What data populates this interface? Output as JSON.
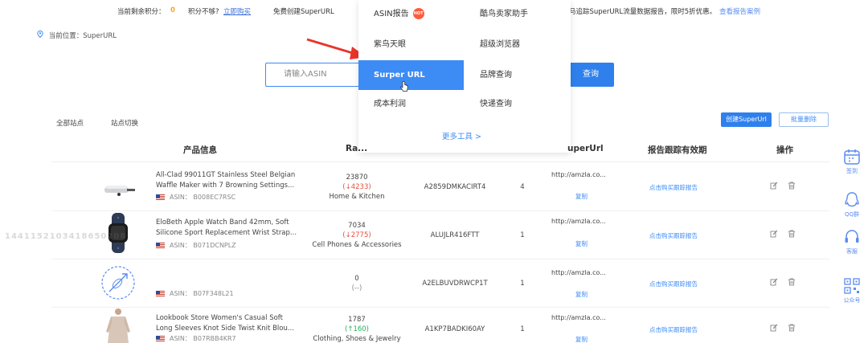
{
  "topbar": {
    "credits_label": "当前剩余积分：",
    "credits_value": "0",
    "not_enough": "积分不够?",
    "buy_now": "立即购买",
    "free_create": "免费创建SuperURL",
    "promo": "马追踪SuperURL流量数据报告，限时5折优惠。",
    "view_sample": "查看报告案例"
  },
  "location": {
    "label": "当前位置：SuperURL"
  },
  "search": {
    "placeholder": "请输入ASIN",
    "query_button": "查询"
  },
  "menu": {
    "items": [
      {
        "label": "ASIN报告",
        "badge": "HOT"
      },
      {
        "label": "酷鸟卖家助手"
      },
      {
        "label": "紫鸟天眼"
      },
      {
        "label": "超级浏览器"
      },
      {
        "label": "Surper URL"
      },
      {
        "label": "品牌查询"
      },
      {
        "label": "成本利润"
      },
      {
        "label": "快递查询"
      }
    ],
    "more": "更多工具 >"
  },
  "filters": {
    "all_sites": "全部站点",
    "switch_site": "站点切换"
  },
  "actions": {
    "create": "创建SuperUrl",
    "batch_delete": "批量删除"
  },
  "table": {
    "headers": {
      "product": "产品信息",
      "rank": "Ra...",
      "superurl": "uperUrl",
      "tracking": "报告跟踪有效期",
      "ops": "操作"
    },
    "rows": [
      {
        "title": "All-Clad 99011GT Stainless Steel Belgian Waffle Maker with 7 Browning Settings...",
        "asin": "ASIN： B008EC7RSC",
        "rank": "23870",
        "rank_change": "(↓4233)",
        "category": "Home & Kitchen",
        "asin_code": "A2859DMKACIRT4",
        "count": "4",
        "url": "http://amzla.co...",
        "copy": "复制",
        "report": "点击购买跟踪报告"
      },
      {
        "title": "EloBeth Apple Watch Band 42mm, Soft Silicone Sport Replacement Wrist Strap...",
        "asin": "ASIN： B071DCNPLZ",
        "rank": "7034",
        "rank_change": "(↓2775)",
        "category": "Cell Phones & Accessories",
        "asin_code": "ALUJLR416FTT",
        "count": "1",
        "url": "http://amzla.co...",
        "copy": "复制",
        "report": "点击购买跟踪报告"
      },
      {
        "title": "",
        "asin": "ASIN： B07F348L21",
        "rank": "0",
        "rank_change": "(--)",
        "category": "",
        "asin_code": "A2ELBUVDRWCP1T",
        "count": "1",
        "url": "http://amzla.co...",
        "copy": "复制",
        "report": "点击购买跟踪报告"
      },
      {
        "title": "Lookbook Store Women's Casual Soft Long Sleeves Knot Side Twist Knit Blou...",
        "asin": "ASIN： B07RBB4KR7",
        "rank": "1787",
        "rank_change": "(↑160)",
        "category": "Clothing, Shoes & Jewelry",
        "asin_code": "A1KP7BADKI60AY",
        "count": "1",
        "url": "http://amzla.co...",
        "copy": "复制",
        "report": "点击购买跟踪报告"
      }
    ]
  },
  "watermark": "1441152103418650208",
  "sidebar": {
    "checkin": "签到",
    "qq_group": "QQ群",
    "service": "客服",
    "official": "公众号"
  }
}
